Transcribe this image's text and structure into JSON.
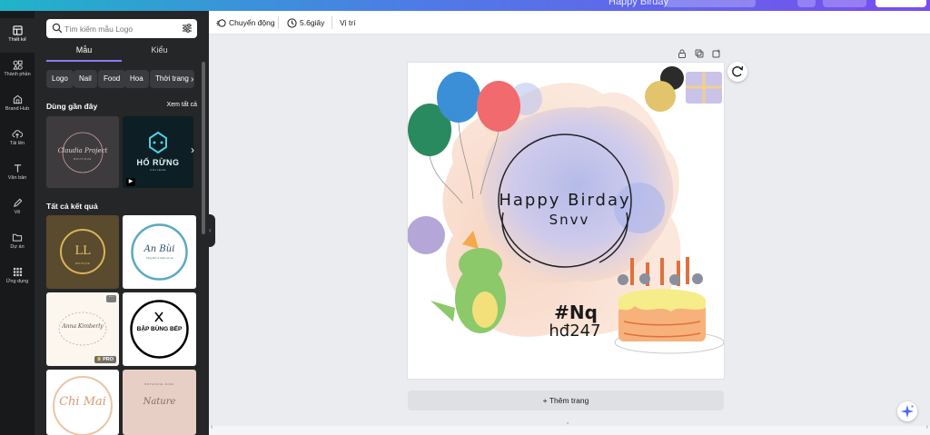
{
  "topbar": {
    "title": "Happy Birday"
  },
  "rail": [
    {
      "label": "Thiết kế",
      "icon": "layout-icon",
      "active": true
    },
    {
      "label": "Thành phần",
      "icon": "shapes-icon"
    },
    {
      "label": "Brand Hub",
      "icon": "brand-icon"
    },
    {
      "label": "Tải lên",
      "icon": "upload-cloud-icon"
    },
    {
      "label": "Văn bản",
      "icon": "text-icon"
    },
    {
      "label": "Vẽ",
      "icon": "draw-icon"
    },
    {
      "label": "Dự án",
      "icon": "folder-icon"
    },
    {
      "label": "Ứng dụng",
      "icon": "apps-icon"
    }
  ],
  "panel": {
    "search_placeholder": "Tìm kiếm mẫu Logo",
    "tabs": [
      "Mẫu",
      "Kiểu"
    ],
    "chips": [
      "Logo",
      "Nail",
      "Food",
      "Hoa",
      "Thời trang"
    ],
    "recent_title": "Dùng gần đây",
    "see_all": "Xem tất cả",
    "all_results_title": "Tất cả kết quả",
    "recent": [
      {
        "name": "Claudia Project",
        "sub": "BOUTIQUE"
      },
      {
        "name": "HỔ RỪNG",
        "sub": "COLLEGE"
      }
    ],
    "results": [
      {
        "name": "LL",
        "sub": "BOUTIQUE"
      },
      {
        "name": "An Bùi",
        "sub": "Trang điểm & Chăm sóc da"
      },
      {
        "name": "Anna Kimberly",
        "sub": ""
      },
      {
        "name": "BẬP BÙNG BẾP",
        "sub": ""
      },
      {
        "name": "Chi Mai",
        "sub": ""
      },
      {
        "name": "Nature",
        "sub": "BOTANICAL MIND"
      }
    ],
    "pro_badge": "PRO"
  },
  "toolbar": {
    "animate": "Chuyển động",
    "duration": "5.6giây",
    "position": "Vị trí"
  },
  "canvas": {
    "title_line1": "Happy Birday",
    "title_line2": "Snvv",
    "tag_line1": "#Nq",
    "tag_line2": "hđ247",
    "add_page": "+ Thêm trang"
  },
  "colors": {
    "accent": "#8b7cf6",
    "rail_bg": "#18191b",
    "panel_bg": "#252627",
    "balloon_blue": "#3b8fd6",
    "balloon_red": "#f06a6e",
    "balloon_green": "#2a8a5f"
  }
}
